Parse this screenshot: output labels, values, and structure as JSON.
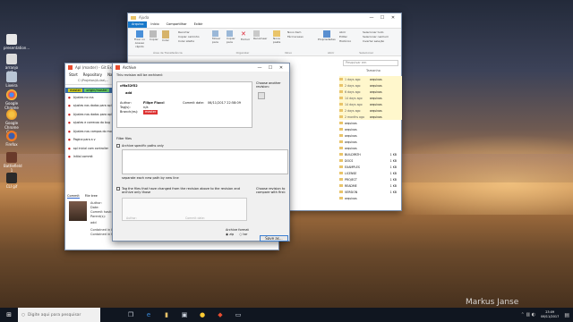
{
  "desktop": {
    "watermark": "Markus Janse",
    "icons": [
      {
        "label": "presentation..."
      },
      {
        "label": "arranjo ref..."
      },
      {
        "label": "Lixeira"
      },
      {
        "label": "Google Chrome"
      },
      {
        "label": "Google Chrome Can..."
      },
      {
        "label": "Firefox"
      },
      {
        "label": "Battlefield 1"
      },
      {
        "label": "CLI gif"
      }
    ]
  },
  "explorer": {
    "title": "Ajuda",
    "tabs": [
      "Arquivo",
      "Início",
      "Compartilhar",
      "Exibir"
    ],
    "ribbon": [
      "Fixar no Acesso rápido",
      "Copiar",
      "Colar",
      "Recortar",
      "Copiar caminho",
      "Colar atalho",
      "Mover para",
      "Copiar para",
      "Excluir",
      "Renomear",
      "Nova pasta",
      "Novo item",
      "Fácil acesso",
      "Propriedades",
      "Abrir",
      "Editar",
      "Histórico",
      "Selecionar tudo",
      "Selecionar nenhum",
      "Inverter seleção"
    ],
    "groups": [
      "Área de Transferência",
      "Organizar",
      "Novo",
      "Abrir",
      "Selecionar"
    ],
    "search_placeholder": "Pesquisar em",
    "size_header": "Tamanho",
    "dates": [
      "1 days ago",
      "2 days ago",
      "6 days ago",
      "14 days ago",
      "14 days ago",
      "2 days ago",
      "2 months ago"
    ],
    "files": [
      "arquivos",
      "arquivos",
      "arquivos",
      "arquivos",
      "arquivos",
      "arquivos",
      "arquivos",
      "arquivos",
      "arquivos",
      "arquivos",
      "arquivos",
      "arquivos",
      "BUILDPATH",
      "DOCS",
      "EXAMPLES",
      "LICENSE",
      "PROJECT",
      "README",
      "VERSION",
      "arquivos"
    ],
    "sizes": [
      "1 KB",
      "1 KB",
      "1 KB",
      "1 KB",
      "1 KB",
      "1 KB",
      "1 KB"
    ]
  },
  "gitext": {
    "title": "Apl (master) - Git Extensions",
    "menu": [
      "Start",
      "Repository",
      "Navigate",
      "Plugins",
      "Help"
    ],
    "path": "C:\\Projetos\\Aulas\\...",
    "branch": "master",
    "origin": "origin/master",
    "commits": [
      "Ajustes no css",
      "ajustes nos dados para apl",
      "Ajustes nos dados para apl",
      "ajustes e correcao do bug",
      "Ajustes nos campos do modal",
      "Pagina para a v",
      "apl inicial com controller",
      "Initial commit"
    ],
    "tabs": [
      "Commit",
      "File tree"
    ],
    "details": [
      "Author:",
      "Date:",
      "Commit hash:",
      "Parent(s):"
    ],
    "contained": [
      "Contained in branches:",
      "Contained in tags:"
    ],
    "msg": "add"
  },
  "archive": {
    "title": "Archive",
    "heading": "This revision will be archived:",
    "hash": "cf6a52f52",
    "message": "add",
    "author_label": "Author:",
    "author": "Filipe Flucci",
    "commit_date_label": "Commit date:",
    "commit_date": "06/11/2017 22:58:09",
    "tags_label": "Tag(s):",
    "tags": "n/a",
    "branch_label": "Branch(es):",
    "branch": "master",
    "choose_another": "Choose another revision:",
    "filter_files": "Filter files",
    "archive_specific": "Archive specific paths only",
    "separate_hint": "separate each new path by new line",
    "changed_files": "Tag the files that have changed from the revision above to the revision and archive only those",
    "choose_revision_compare": "Choose revision to compare with first:",
    "author2": "Author:",
    "commit_date2": "Commit date:",
    "format_label": "Archive format",
    "fmt_zip": "zip",
    "fmt_tar": "tar",
    "save_button": "Save as..."
  },
  "taskbar": {
    "search": "Digite aqui para pesquisar",
    "time": "23:09",
    "date": "06/11/2017"
  }
}
